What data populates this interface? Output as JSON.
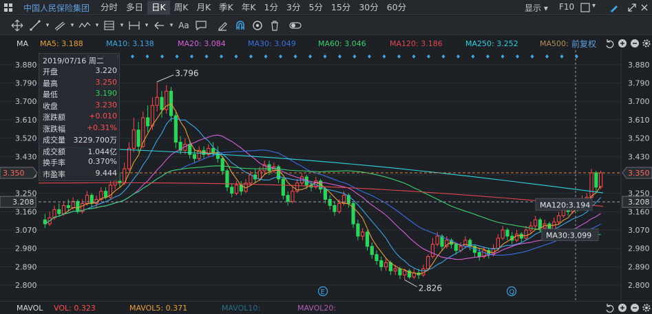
{
  "topbar": {
    "stock_name": "中国人民保险集团",
    "periods": [
      "分时",
      "多日",
      "日K",
      "周K",
      "月K",
      "季K",
      "年K",
      "1分",
      "3分",
      "5分",
      "15分",
      "30分",
      "60分"
    ],
    "active_period": "日K",
    "display_label": "显示",
    "f10_label": "F10"
  },
  "toolbar": {
    "font_tool_label": "Aa"
  },
  "ma_legend": {
    "indicator": "MA",
    "items": [
      {
        "label": "MA5: 3.188",
        "color": "#e7a13b"
      },
      {
        "label": "MA10: 3.138",
        "color": "#3fa6e6"
      },
      {
        "label": "MA20: 3.084",
        "color": "#d95fd9"
      },
      {
        "label": "MA30: 3.049",
        "color": "#3b6fe6"
      },
      {
        "label": "MA60: 3.046",
        "color": "#3ecf6e"
      },
      {
        "label": "MA120: 3.186",
        "color": "#e0474c"
      },
      {
        "label": "MA250: 3.252",
        "color": "#31d3e0"
      },
      {
        "label": "MA500:",
        "color": "#b5905a"
      }
    ],
    "adjust_label": "前复权"
  },
  "info_box": {
    "date": "2019/07/16 周二",
    "rows": [
      {
        "label": "开盘",
        "value": "3.220",
        "color": "#d6d9de"
      },
      {
        "label": "最高",
        "value": "3.250",
        "color": "#ff4d4d"
      },
      {
        "label": "最低",
        "value": "3.190",
        "color": "#2fd35a"
      },
      {
        "label": "收盘",
        "value": "3.230",
        "color": "#ff4d4d"
      },
      {
        "label": "涨跌额",
        "value": "+0.010",
        "color": "#ff4d4d"
      },
      {
        "label": "涨跌幅",
        "value": "+0.31%",
        "color": "#ff4d4d"
      },
      {
        "label": "成交量",
        "value": "3229.700万",
        "color": "#d6d9de"
      },
      {
        "label": "成交额",
        "value": "1.044亿",
        "color": "#d6d9de"
      },
      {
        "label": "换手率",
        "value": "0.370%",
        "color": "#d6d9de"
      },
      {
        "label": "市盈率",
        "value": "9.444",
        "color": "#d6d9de"
      }
    ]
  },
  "volume_bar": {
    "indicator": "MAVOL",
    "items": [
      {
        "label": "VOL: 0.323",
        "color": "#ff4d4d"
      },
      {
        "label": "MAVOL5: 0.371",
        "color": "#e7a13b"
      },
      {
        "label": "MAVOL10:",
        "color": "#2a6d8a"
      },
      {
        "label": "MAVOL20:",
        "color": "#b35fb3"
      }
    ]
  },
  "chart_data": {
    "type": "candlestick",
    "y_ticks": [
      3.88,
      3.79,
      3.7,
      3.61,
      3.52,
      3.43,
      3.34,
      3.25,
      3.16,
      3.07,
      2.98,
      2.89,
      2.8
    ],
    "y_range": [
      2.77,
      3.93
    ],
    "y_tick_labels": [
      "3.880",
      "3.790",
      "3.700",
      "3.610",
      "3.520",
      "3.430",
      "3.340",
      "3.250",
      "3.160",
      "3.070",
      "2.980",
      "2.890",
      "2.800"
    ],
    "current_price": {
      "value": 3.35,
      "label": "3.350"
    },
    "reference_price": {
      "value": 3.208,
      "label": "3.208"
    },
    "high_marker": {
      "value": 3.796,
      "label": "3.796"
    },
    "low_marker": {
      "value": 2.826,
      "label": "2.826"
    },
    "annotations": [
      {
        "label": "MA120:3.194",
        "color": "#e0474c"
      },
      {
        "label": "MA30:3.099",
        "color": "#3b6fe6"
      }
    ],
    "event_markers": [
      "E",
      "Q"
    ],
    "candles": [
      [
        3.12,
        3.1,
        3.15,
        3.08
      ],
      [
        3.1,
        3.13,
        3.16,
        3.09
      ],
      [
        3.13,
        3.17,
        3.19,
        3.12
      ],
      [
        3.17,
        3.15,
        3.2,
        3.14
      ],
      [
        3.15,
        3.19,
        3.21,
        3.14
      ],
      [
        3.19,
        3.18,
        3.22,
        3.16
      ],
      [
        3.18,
        3.21,
        3.23,
        3.17
      ],
      [
        3.21,
        3.16,
        3.22,
        3.15
      ],
      [
        3.16,
        3.2,
        3.22,
        3.15
      ],
      [
        3.2,
        3.24,
        3.26,
        3.19
      ],
      [
        3.24,
        3.2,
        3.25,
        3.18
      ],
      [
        3.2,
        3.22,
        3.24,
        3.18
      ],
      [
        3.22,
        3.26,
        3.28,
        3.21
      ],
      [
        3.26,
        3.23,
        3.28,
        3.22
      ],
      [
        3.23,
        3.29,
        3.31,
        3.22
      ],
      [
        3.29,
        3.31,
        3.34,
        3.27
      ],
      [
        3.31,
        3.3,
        3.35,
        3.28
      ],
      [
        3.3,
        3.37,
        3.4,
        3.29
      ],
      [
        3.37,
        3.47,
        3.5,
        3.36
      ],
      [
        3.47,
        3.56,
        3.62,
        3.45
      ],
      [
        3.56,
        3.48,
        3.6,
        3.45
      ],
      [
        3.48,
        3.62,
        3.65,
        3.47
      ],
      [
        3.62,
        3.58,
        3.68,
        3.55
      ],
      [
        3.58,
        3.68,
        3.72,
        3.56
      ],
      [
        3.68,
        3.72,
        3.796,
        3.65
      ],
      [
        3.72,
        3.66,
        3.75,
        3.62
      ],
      [
        3.66,
        3.75,
        3.78,
        3.64
      ],
      [
        3.75,
        3.63,
        3.77,
        3.6
      ],
      [
        3.63,
        3.5,
        3.65,
        3.47
      ],
      [
        3.5,
        3.46,
        3.53,
        3.44
      ],
      [
        3.46,
        3.49,
        3.52,
        3.44
      ],
      [
        3.49,
        3.44,
        3.51,
        3.42
      ],
      [
        3.44,
        3.42,
        3.47,
        3.4
      ],
      [
        3.42,
        3.46,
        3.48,
        3.41
      ],
      [
        3.46,
        3.44,
        3.48,
        3.42
      ],
      [
        3.44,
        3.47,
        3.49,
        3.43
      ],
      [
        3.47,
        3.45,
        3.5,
        3.43
      ],
      [
        3.45,
        3.42,
        3.48,
        3.4
      ],
      [
        3.42,
        3.36,
        3.43,
        3.34
      ],
      [
        3.36,
        3.28,
        3.37,
        3.26
      ],
      [
        3.28,
        3.25,
        3.3,
        3.23
      ],
      [
        3.25,
        3.29,
        3.31,
        3.24
      ],
      [
        3.29,
        3.26,
        3.31,
        3.24
      ],
      [
        3.26,
        3.3,
        3.32,
        3.25
      ],
      [
        3.3,
        3.34,
        3.36,
        3.29
      ],
      [
        3.34,
        3.32,
        3.37,
        3.3
      ],
      [
        3.32,
        3.36,
        3.38,
        3.31
      ],
      [
        3.36,
        3.39,
        3.41,
        3.34
      ],
      [
        3.39,
        3.36,
        3.41,
        3.34
      ],
      [
        3.36,
        3.38,
        3.4,
        3.35
      ],
      [
        3.38,
        3.32,
        3.39,
        3.3
      ],
      [
        3.32,
        3.24,
        3.33,
        3.22
      ],
      [
        3.24,
        3.21,
        3.26,
        3.19
      ],
      [
        3.21,
        3.26,
        3.28,
        3.2
      ],
      [
        3.26,
        3.3,
        3.32,
        3.25
      ],
      [
        3.3,
        3.33,
        3.35,
        3.29
      ],
      [
        3.33,
        3.29,
        3.34,
        3.27
      ],
      [
        3.29,
        3.28,
        3.31,
        3.26
      ],
      [
        3.28,
        3.31,
        3.33,
        3.27
      ],
      [
        3.31,
        3.27,
        3.32,
        3.25
      ],
      [
        3.27,
        3.22,
        3.28,
        3.2
      ],
      [
        3.22,
        3.19,
        3.24,
        3.17
      ],
      [
        3.19,
        3.16,
        3.21,
        3.14
      ],
      [
        3.16,
        3.2,
        3.22,
        3.15
      ],
      [
        3.2,
        3.24,
        3.26,
        3.19
      ],
      [
        3.24,
        3.2,
        3.25,
        3.18
      ],
      [
        3.2,
        3.1,
        3.21,
        3.08
      ],
      [
        3.1,
        3.04,
        3.12,
        3.02
      ],
      [
        3.04,
        3.06,
        3.08,
        3.02
      ],
      [
        3.06,
        2.99,
        3.07,
        2.97
      ],
      [
        2.99,
        2.95,
        3.01,
        2.93
      ],
      [
        2.95,
        2.92,
        2.97,
        2.9
      ],
      [
        2.92,
        2.89,
        2.94,
        2.87
      ],
      [
        2.89,
        2.91,
        2.93,
        2.87
      ],
      [
        2.91,
        2.87,
        2.92,
        2.85
      ],
      [
        2.87,
        2.88,
        2.9,
        2.85
      ],
      [
        2.88,
        2.85,
        2.89,
        2.83
      ],
      [
        2.85,
        2.87,
        2.88,
        2.826
      ],
      [
        2.87,
        2.84,
        2.88,
        2.83
      ],
      [
        2.84,
        2.86,
        2.88,
        2.83
      ],
      [
        2.86,
        2.85,
        2.88,
        2.83
      ],
      [
        2.85,
        2.88,
        2.9,
        2.84
      ],
      [
        2.88,
        2.94,
        2.95,
        2.87
      ],
      [
        2.94,
        3.0,
        3.03,
        2.93
      ],
      [
        3.0,
        3.04,
        3.06,
        2.99
      ],
      [
        3.04,
        2.99,
        3.05,
        2.97
      ],
      [
        2.99,
        3.02,
        3.04,
        2.98
      ],
      [
        3.02,
        3.0,
        3.03,
        2.98
      ],
      [
        3.0,
        2.97,
        3.01,
        2.95
      ],
      [
        2.97,
        2.99,
        3.01,
        2.96
      ],
      [
        2.99,
        3.02,
        3.04,
        2.98
      ],
      [
        3.02,
        2.99,
        3.03,
        2.97
      ],
      [
        2.99,
        2.96,
        3.0,
        2.94
      ],
      [
        2.96,
        2.94,
        2.98,
        2.92
      ],
      [
        2.94,
        2.97,
        2.99,
        2.93
      ],
      [
        2.97,
        2.95,
        2.98,
        2.93
      ],
      [
        2.95,
        2.98,
        3.0,
        2.94
      ],
      [
        2.98,
        3.03,
        3.05,
        2.97
      ],
      [
        3.03,
        3.07,
        3.09,
        3.02
      ],
      [
        3.07,
        3.04,
        3.08,
        3.02
      ],
      [
        3.04,
        3.02,
        3.06,
        3.0
      ],
      [
        3.02,
        3.05,
        3.07,
        3.01
      ],
      [
        3.05,
        3.03,
        3.06,
        3.01
      ],
      [
        3.03,
        3.07,
        3.09,
        3.02
      ],
      [
        3.07,
        3.09,
        3.11,
        3.05
      ],
      [
        3.09,
        3.12,
        3.14,
        3.08
      ],
      [
        3.12,
        3.08,
        3.13,
        3.06
      ],
      [
        3.08,
        3.1,
        3.12,
        3.07
      ],
      [
        3.1,
        3.06,
        3.11,
        3.05
      ],
      [
        3.06,
        3.11,
        3.13,
        3.05
      ],
      [
        3.11,
        3.14,
        3.16,
        3.1
      ],
      [
        3.14,
        3.18,
        3.2,
        3.13
      ],
      [
        3.18,
        3.16,
        3.21,
        3.14
      ],
      [
        3.16,
        3.2,
        3.22,
        3.15
      ],
      [
        3.2,
        3.18,
        3.22,
        3.16
      ],
      [
        3.18,
        3.22,
        3.24,
        3.17
      ],
      [
        3.22,
        3.23,
        3.25,
        3.19
      ],
      [
        3.23,
        3.35,
        3.37,
        3.22
      ],
      [
        3.35,
        3.28,
        3.36,
        3.26
      ],
      [
        3.28,
        3.35,
        3.36,
        3.27
      ]
    ]
  }
}
